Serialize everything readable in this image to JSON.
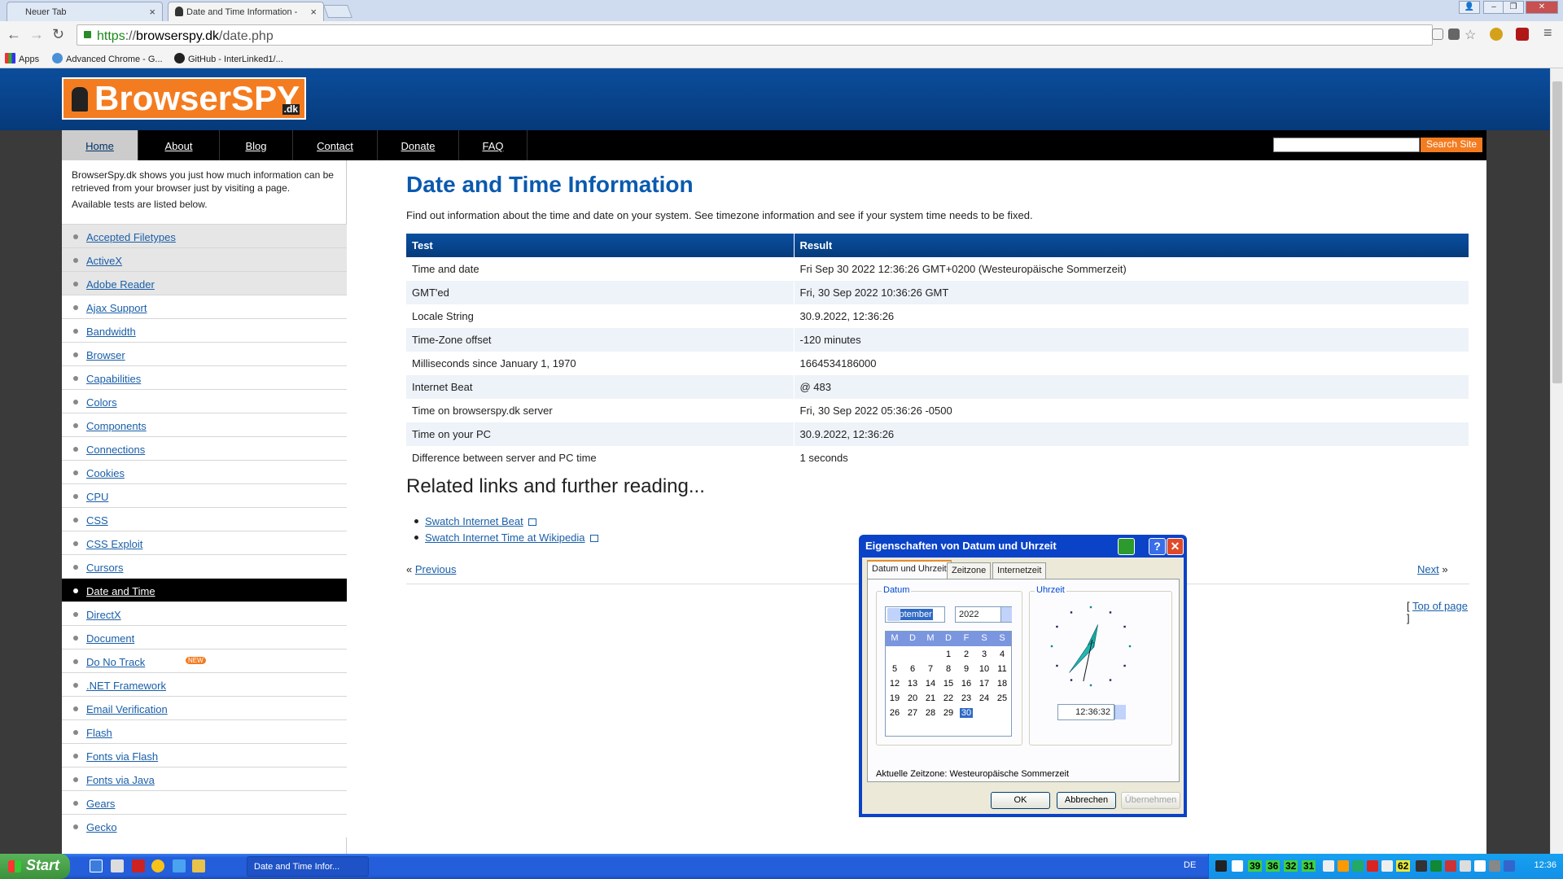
{
  "browser": {
    "tabs": [
      {
        "title": "Neuer Tab",
        "active": false
      },
      {
        "title": "Date and Time Information -",
        "active": true
      }
    ],
    "url": {
      "scheme": "https",
      "separator": "://",
      "host": "browserspy.dk",
      "path": "/date.php"
    },
    "bookmarks": [
      {
        "label": "Apps"
      },
      {
        "label": "Advanced Chrome - G..."
      },
      {
        "label": "GitHub - InterLinked1/..."
      }
    ]
  },
  "site": {
    "logo_text": "BrowserSPY",
    "logo_suffix": ".dk",
    "nav": [
      {
        "label": "Home",
        "selected": true
      },
      {
        "label": "About"
      },
      {
        "label": "Blog"
      },
      {
        "label": "Contact"
      },
      {
        "label": "Donate"
      },
      {
        "label": "FAQ"
      }
    ],
    "search_button": "Search Site",
    "search_value": ""
  },
  "sidebar": {
    "intro": "BrowserSpy.dk shows you just how much information can be retrieved from your browser just by visiting a page.",
    "intro2": "Available tests are listed below.",
    "items": [
      {
        "label": "Accepted Filetypes"
      },
      {
        "label": "ActiveX"
      },
      {
        "label": "Adobe Reader"
      },
      {
        "label": "Ajax Support"
      },
      {
        "label": "Bandwidth"
      },
      {
        "label": "Browser"
      },
      {
        "label": "Capabilities"
      },
      {
        "label": "Colors"
      },
      {
        "label": "Components"
      },
      {
        "label": "Connections"
      },
      {
        "label": "Cookies"
      },
      {
        "label": "CPU"
      },
      {
        "label": "CSS"
      },
      {
        "label": "CSS Exploit"
      },
      {
        "label": "Cursors"
      },
      {
        "label": "Date and Time",
        "selected": true
      },
      {
        "label": "DirectX"
      },
      {
        "label": "Document"
      },
      {
        "label": "Do No Track",
        "badge": "NEW"
      },
      {
        "label": ".NET Framework"
      },
      {
        "label": "Email Verification"
      },
      {
        "label": "Flash"
      },
      {
        "label": "Fonts via Flash"
      },
      {
        "label": "Fonts via Java"
      },
      {
        "label": "Gears"
      },
      {
        "label": "Gecko"
      }
    ]
  },
  "main": {
    "title": "Date and Time Information",
    "intro": "Find out information about the time and date on your system. See timezone information and see if your system time needs to be fixed.",
    "table": {
      "headers": [
        "Test",
        "Result"
      ],
      "rows": [
        [
          "Time and date",
          "Fri Sep 30 2022 12:36:26 GMT+0200 (Westeuropäische Sommerzeit)"
        ],
        [
          "GMT'ed",
          "Fri, 30 Sep 2022 10:36:26 GMT"
        ],
        [
          "Locale String",
          "30.9.2022, 12:36:26"
        ],
        [
          "Time-Zone offset",
          "-120 minutes"
        ],
        [
          "Milliseconds since January 1, 1970",
          "1664534186000"
        ],
        [
          "Internet Beat",
          "@ 483"
        ],
        [
          "Time on browserspy.dk server",
          "Fri, 30 Sep 2022 05:36:26 -0500"
        ],
        [
          "Time on your PC",
          "30.9.2022, 12:36:26"
        ],
        [
          "Difference between server and PC time",
          "1 seconds"
        ]
      ]
    },
    "related_title": "Related links and further reading...",
    "related": [
      {
        "label": "Swatch Internet Beat"
      },
      {
        "label": "Swatch Internet Time at Wikipedia"
      }
    ],
    "prev_label": "Previous",
    "next_label": "Next",
    "top_label": "Top of page",
    "prev_prefix": "«",
    "next_suffix": "»",
    "bracket_open": "[",
    "bracket_close": "]"
  },
  "dialog": {
    "title": "Eigenschaften von Datum und Uhrzeit",
    "help_glyph": "?",
    "close_glyph": "✕",
    "tabs": [
      {
        "label": "Datum und Uhrzeit",
        "selected": true
      },
      {
        "label": "Zeitzone"
      },
      {
        "label": "Internetzeit"
      }
    ],
    "date_group": "Datum",
    "time_group": "Uhrzeit",
    "month": "September",
    "year": "2022",
    "weekdays": [
      "M",
      "D",
      "M",
      "D",
      "F",
      "S",
      "S"
    ],
    "selected_day": "30",
    "time": "12:36:32",
    "clock": {
      "hours": 12,
      "minutes": 36,
      "seconds": 32
    },
    "timezone": "Aktuelle Zeitzone: Westeuropäische Sommerzeit",
    "ok": "OK",
    "cancel": "Abbrechen",
    "apply": "Übernehmen"
  },
  "taskbar": {
    "start": "Start",
    "window": "Date and Time Infor...",
    "lang": "DE",
    "tray_numbers": [
      "39",
      "36",
      "32",
      "31"
    ],
    "tray_badge": "62",
    "clock": "12:36",
    "colors": {
      "taskbar": "#245edb",
      "start": "#3a913a",
      "tray": "#1290e8"
    }
  }
}
